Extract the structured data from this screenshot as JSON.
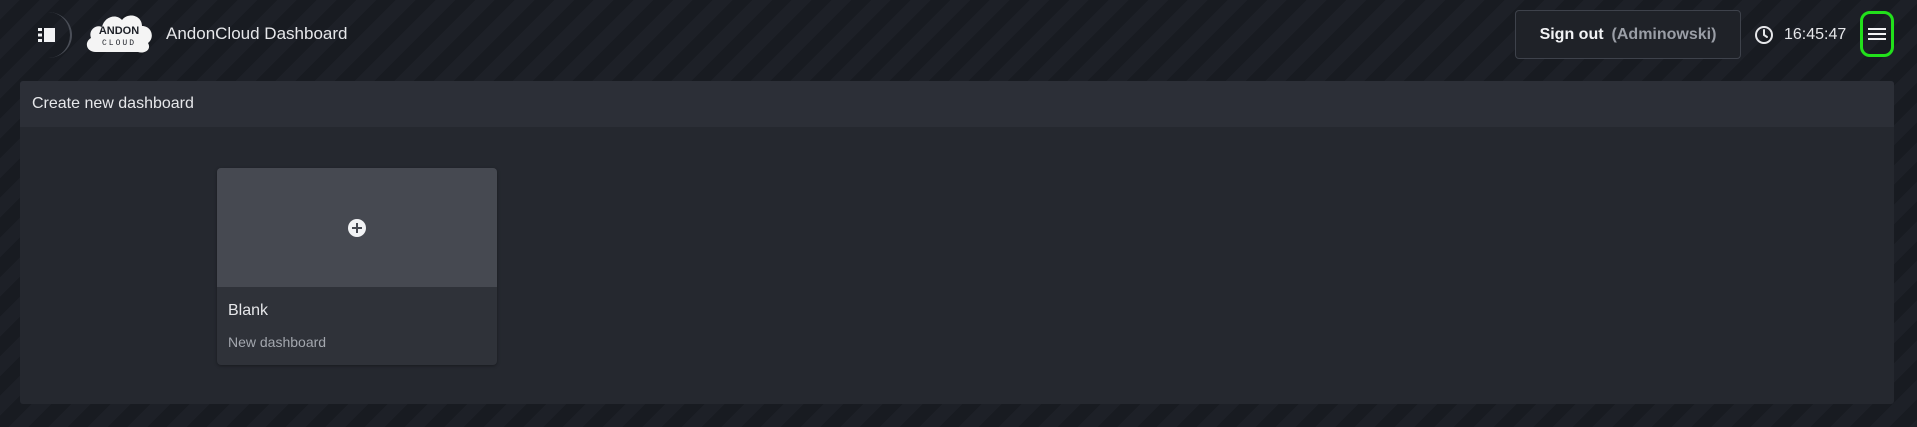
{
  "header": {
    "app_title": "AndonCloud Dashboard",
    "logo_text_top": "ANDON",
    "logo_text_bottom": "CLOUD",
    "sign_out_label": "Sign out",
    "user_label": "(Adminowski)",
    "time": "16:45:47",
    "icons": {
      "sidebar_toggle": "sidebar-list-icon",
      "clock": "clock-icon",
      "menu": "hamburger-menu-icon",
      "add": "plus-circle-icon"
    }
  },
  "panel": {
    "title": "Create new dashboard",
    "templates": [
      {
        "title": "Blank",
        "subtitle": "New dashboard"
      }
    ]
  },
  "colors": {
    "background": "#1b1e24",
    "panel": "#25282f",
    "panel_header": "#2c2f37",
    "card_preview": "#464951",
    "highlight": "#22e01b"
  }
}
